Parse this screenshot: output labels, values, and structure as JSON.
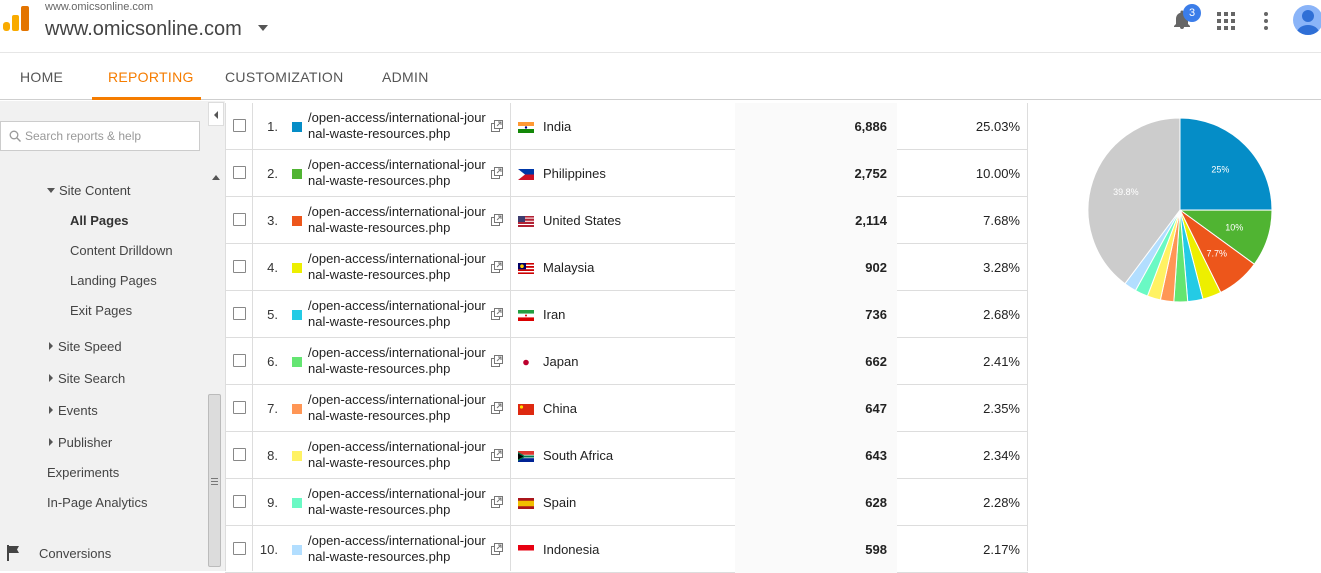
{
  "header": {
    "site_small": "www.omicsonline.com",
    "site_big": "www.omicsonline.com",
    "notification_count": "3",
    "accent": "#f57c00"
  },
  "nav": {
    "tabs": [
      {
        "label": "HOME",
        "active": false
      },
      {
        "label": "REPORTING",
        "active": true
      },
      {
        "label": "CUSTOMIZATION",
        "active": false
      },
      {
        "label": "ADMIN",
        "active": false
      }
    ]
  },
  "sidebar": {
    "search_placeholder": "Search reports & help",
    "site_content": "Site Content",
    "sub_items": [
      "All Pages",
      "Content Drilldown",
      "Landing Pages",
      "Exit Pages"
    ],
    "collapsed_items": [
      "Site Speed",
      "Site Search",
      "Events",
      "Publisher"
    ],
    "plain_items": [
      "Experiments",
      "In-Page Analytics"
    ],
    "conversions": "Conversions"
  },
  "table": {
    "rows": [
      {
        "index": "1.",
        "page": "/open-access/international-journal-waste-resources.php",
        "country": "India",
        "value": "6,886",
        "percent": "25.03%",
        "color": "#058dc7",
        "flag": "india"
      },
      {
        "index": "2.",
        "page": "/open-access/international-journal-waste-resources.php",
        "country": "Philippines",
        "value": "2,752",
        "percent": "10.00%",
        "color": "#50b432",
        "flag": "philippines"
      },
      {
        "index": "3.",
        "page": "/open-access/international-journal-waste-resources.php",
        "country": "United States",
        "value": "2,114",
        "percent": "7.68%",
        "color": "#ed561b",
        "flag": "usa"
      },
      {
        "index": "4.",
        "page": "/open-access/international-journal-waste-resources.php",
        "country": "Malaysia",
        "value": "902",
        "percent": "3.28%",
        "color": "#edef00",
        "flag": "malaysia"
      },
      {
        "index": "5.",
        "page": "/open-access/international-journal-waste-resources.php",
        "country": "Iran",
        "value": "736",
        "percent": "2.68%",
        "color": "#24cbe5",
        "flag": "iran"
      },
      {
        "index": "6.",
        "page": "/open-access/international-journal-waste-resources.php",
        "country": "Japan",
        "value": "662",
        "percent": "2.41%",
        "color": "#64e572",
        "flag": "japan"
      },
      {
        "index": "7.",
        "page": "/open-access/international-journal-waste-resources.php",
        "country": "China",
        "value": "647",
        "percent": "2.35%",
        "color": "#ff9655",
        "flag": "china"
      },
      {
        "index": "8.",
        "page": "/open-access/international-journal-waste-resources.php",
        "country": "South Africa",
        "value": "643",
        "percent": "2.34%",
        "color": "#fff263",
        "flag": "southafrica"
      },
      {
        "index": "9.",
        "page": "/open-access/international-journal-waste-resources.php",
        "country": "Spain",
        "value": "628",
        "percent": "2.28%",
        "color": "#6af9c4",
        "flag": "spain"
      },
      {
        "index": "10.",
        "page": "/open-access/international-journal-waste-resources.php",
        "country": "Indonesia",
        "value": "598",
        "percent": "2.17%",
        "color": "#b2deff",
        "flag": "indonesia"
      }
    ]
  },
  "pie": {
    "slices": [
      25.03,
      10.0,
      7.68,
      3.28,
      2.68,
      2.41,
      2.35,
      2.34,
      2.28,
      2.17,
      39.8
    ],
    "colors": [
      "#058dc7",
      "#50b432",
      "#ed561b",
      "#edef00",
      "#24cbe5",
      "#64e572",
      "#ff9655",
      "#fff263",
      "#6af9c4",
      "#b2deff",
      "#cccccc"
    ],
    "labels": [
      "25%",
      "10%",
      "7.7%",
      "",
      "",
      "",
      "",
      "",
      "",
      "",
      "39.8%"
    ]
  }
}
